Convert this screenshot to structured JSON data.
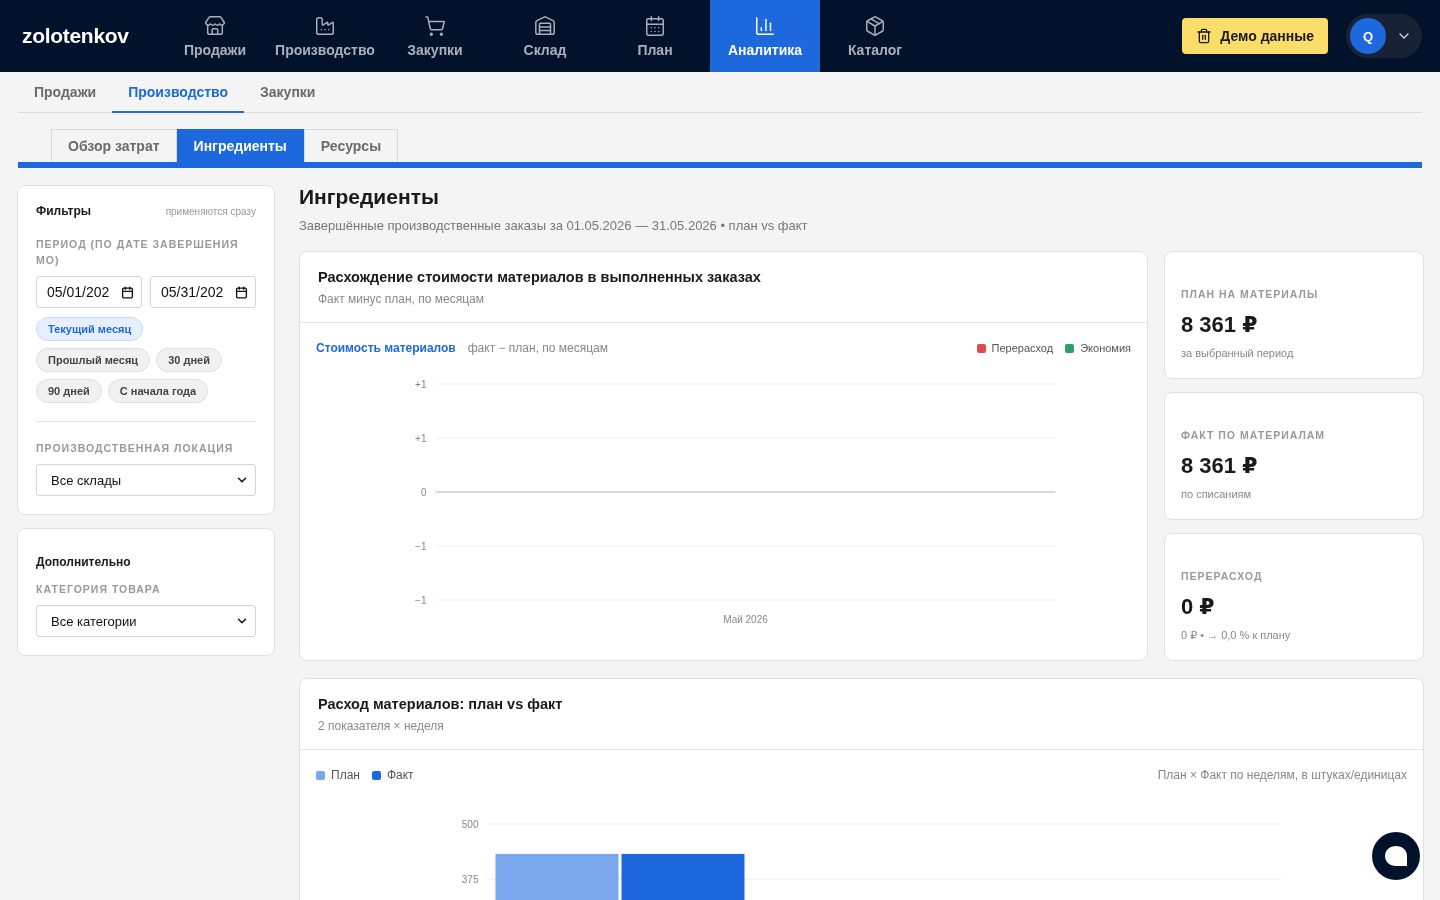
{
  "brand": "zolotenkov",
  "nav": [
    {
      "label": "Продажи",
      "selected": false
    },
    {
      "label": "Производство",
      "selected": false
    },
    {
      "label": "Закупки",
      "selected": false
    },
    {
      "label": "Склад",
      "selected": false
    },
    {
      "label": "План",
      "selected": false
    },
    {
      "label": "Аналитика",
      "selected": true
    },
    {
      "label": "Каталог",
      "selected": false
    }
  ],
  "demo_button": "Демо данные",
  "user": {
    "initial": "Q"
  },
  "section_tabs": [
    {
      "label": "Продажи",
      "selected": false
    },
    {
      "label": "Производство",
      "selected": true
    },
    {
      "label": "Закупки",
      "selected": false
    }
  ],
  "view_tabs": [
    {
      "label": "Обзор затрат",
      "selected": false
    },
    {
      "label": "Ингредиенты",
      "selected": true
    },
    {
      "label": "Ресурсы",
      "selected": false
    }
  ],
  "filters": {
    "title": "Фильтры",
    "hint": "применяются сразу",
    "period_label": "ПЕРИОД (ПО ДАТЕ ЗАВЕРШЕНИЯ МО)",
    "date_from": "05/01/202",
    "date_to": "05/31/202",
    "presets": [
      {
        "label": "Текущий месяц",
        "selected": true
      },
      {
        "label": "Прошлый месяц",
        "selected": false
      },
      {
        "label": "30 дней",
        "selected": false
      },
      {
        "label": "90 дней",
        "selected": false
      },
      {
        "label": "С начала года",
        "selected": false
      }
    ],
    "location_label": "ПРОИЗВОДСТВЕННАЯ ЛОКАЦИЯ",
    "location_value": "Все склады"
  },
  "extra": {
    "title": "Дополнительно",
    "category_label": "КАТЕГОРИЯ ТОВАРА",
    "category_value": "Все категории"
  },
  "page": {
    "title": "Ингредиенты",
    "subtitle": "Завершённые производственные заказы за 01.05.2026 — 31.05.2026 • план vs факт"
  },
  "variance_card": {
    "title": "Расхождение стоимости материалов в выполненных заказах",
    "subtitle": "Факт минус план, по месяцам",
    "chart_title": "Стоимость материалов",
    "chart_note": "факт − план, по месяцам",
    "chart_data": {
      "type": "bar",
      "categories": [
        "Май 2026"
      ],
      "ylim": [
        -1,
        1
      ],
      "yticks": [
        {
          "value": 1,
          "label": "+1"
        },
        {
          "value": 0.5,
          "label": "+1"
        },
        0,
        {
          "value": -0.5,
          "label": "−1"
        },
        {
          "value": -1,
          "label": "−1"
        }
      ],
      "series": [
        {
          "name": "Перерасход",
          "color": "#dc4b4b",
          "values": [
            0
          ]
        },
        {
          "name": "Экономия",
          "color": "#2e9e6a",
          "values": [
            0
          ]
        }
      ]
    }
  },
  "kpis": [
    {
      "label": "ПЛАН НА МАТЕРИАЛЫ",
      "value": "8 361 ₽",
      "note": "за выбранный период"
    },
    {
      "label": "ФАКТ ПО МАТЕРИАЛАМ",
      "value": "8 361 ₽",
      "note": "по списаниям"
    },
    {
      "label": "ПЕРЕРАСХОД",
      "value": "0 ₽",
      "note": "0 ₽ • → 0,0 % к плану"
    }
  ],
  "usage_card": {
    "title": "Расход материалов: план vs факт",
    "subtitle": "2 показателя × неделя",
    "chart_note": "План × Факт по неделям, в штуках/единицах",
    "chart_data": {
      "type": "bar",
      "ylim": [
        0,
        500
      ],
      "yticks": [
        500,
        375
      ],
      "series": [
        {
          "name": "План",
          "color": "#7aa6ec",
          "values": [
            432
          ]
        },
        {
          "name": "Факт",
          "color": "#1c68dc",
          "values": [
            432
          ]
        }
      ]
    }
  }
}
